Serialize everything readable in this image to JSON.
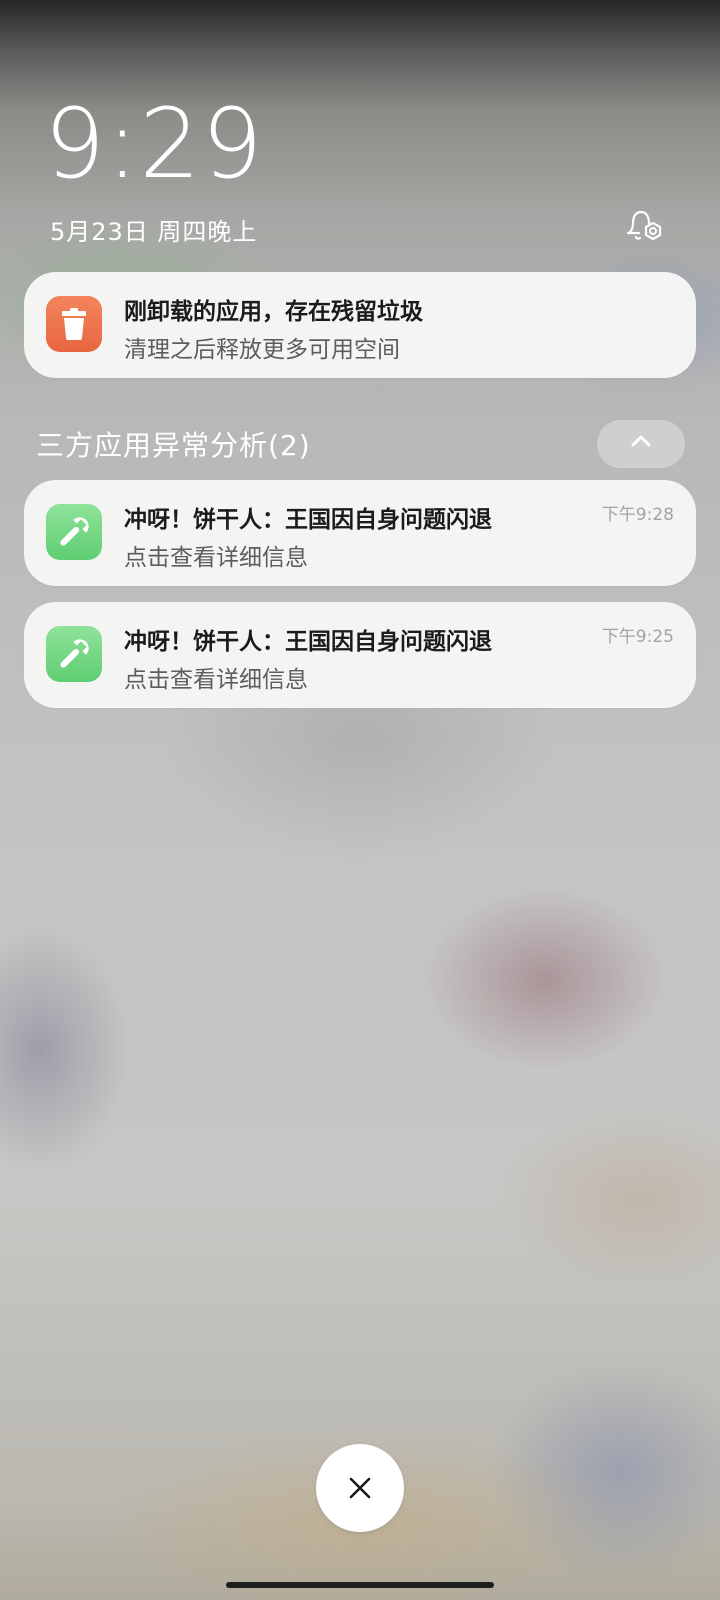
{
  "lockscreen": {
    "time": "9:29",
    "date": "5月23日 周四晚上"
  },
  "notifications": {
    "cleanup": {
      "title": "刚卸载的应用，存在残留垃圾",
      "subtitle": "清理之后释放更多可用空间",
      "icon": "trash-icon"
    },
    "group": {
      "header": "三方应用异常分析(2)",
      "items": [
        {
          "title": "冲呀！饼干人：王国因自身问题闪退",
          "subtitle": "点击查看详细信息",
          "time": "下午9:28",
          "icon": "wrench-icon"
        },
        {
          "title": "冲呀！饼干人：王国因自身问题闪退",
          "subtitle": "点击查看详细信息",
          "time": "下午9:25",
          "icon": "wrench-icon"
        }
      ]
    }
  },
  "colors": {
    "cleanup_icon": "#ED7149",
    "analysis_icon": "#74D884",
    "card_bg": "#F4F4F3"
  }
}
